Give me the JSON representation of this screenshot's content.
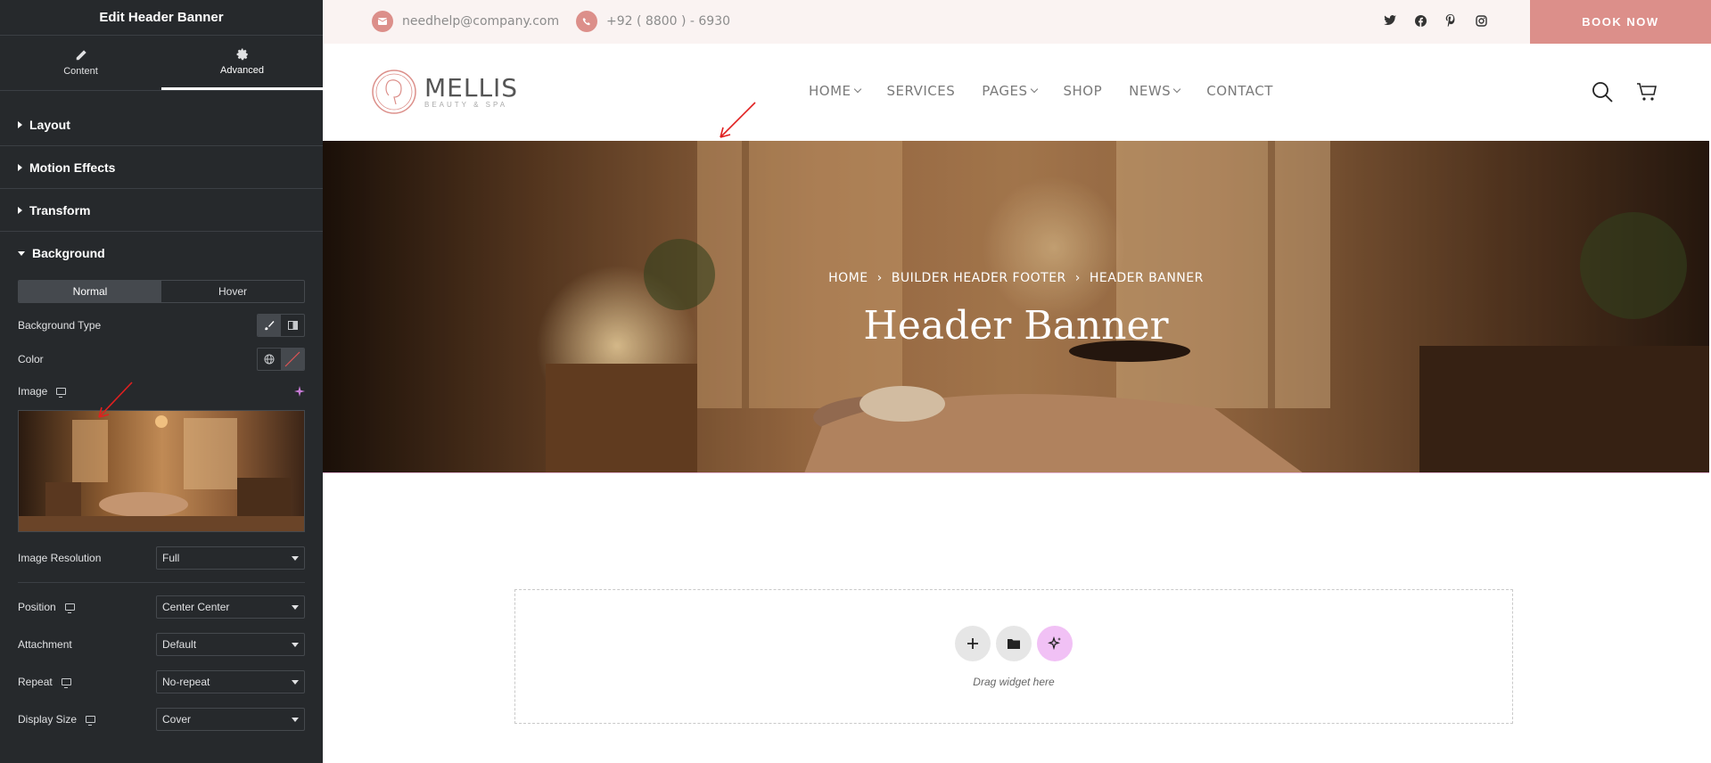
{
  "panel": {
    "title": "Edit Header Banner",
    "tabs": [
      {
        "label": "Content",
        "icon": "pencil-icon"
      },
      {
        "label": "Advanced",
        "icon": "gear-icon",
        "active": true
      }
    ],
    "sections": [
      "Layout",
      "Motion Effects",
      "Transform",
      "Background"
    ],
    "background": {
      "state_tabs": [
        "Normal",
        "Hover"
      ],
      "background_type_label": "Background Type",
      "color_label": "Color",
      "image_label": "Image",
      "fields": [
        {
          "label": "Image Resolution",
          "value": "Full"
        },
        {
          "label": "Position",
          "value": "Center Center"
        },
        {
          "label": "Attachment",
          "value": "Default"
        },
        {
          "label": "Repeat",
          "value": "No-repeat"
        },
        {
          "label": "Display Size",
          "value": "Cover"
        }
      ]
    }
  },
  "site": {
    "email": "needhelp@company.com",
    "phone": "+92 ( 8800 ) - 6930",
    "book_now": "BOOK NOW",
    "logo_name": "MELLIS",
    "logo_tagline": "BEAUTY & SPA",
    "menu": [
      {
        "label": "HOME",
        "dropdown": true
      },
      {
        "label": "SERVICES",
        "dropdown": false
      },
      {
        "label": "PAGES",
        "dropdown": true
      },
      {
        "label": "SHOP",
        "dropdown": false
      },
      {
        "label": "NEWS",
        "dropdown": true
      },
      {
        "label": "CONTACT",
        "dropdown": false
      }
    ],
    "breadcrumb": [
      "HOME",
      "BUILDER HEADER FOOTER",
      "HEADER BANNER"
    ],
    "banner_title": "Header Banner",
    "drop_label": "Drag widget here"
  },
  "colors": {
    "panel_bg": "#26292c",
    "accent": "#dc8f8a",
    "topbar_bg": "#faf3f2",
    "ai_button": "#f1c1f5"
  }
}
